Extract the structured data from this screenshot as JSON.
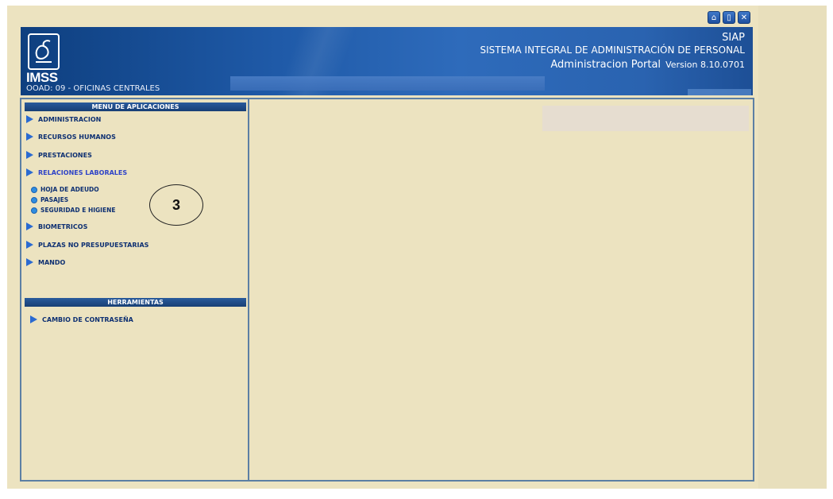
{
  "header": {
    "logo": "IMSS",
    "ooad": "OOAD: 09 - OFICINAS CENTRALES",
    "siap": "SIAP",
    "system_name": "SISTEMA INTEGRAL DE ADMINISTRACIÓN DE PERSONAL",
    "portal": "Administracion Portal",
    "version": "Version 8.10.0701"
  },
  "top_icons": [
    "home-icon",
    "document-icon",
    "close-icon"
  ],
  "menu": {
    "title": "MENU DE APLICACIONES",
    "items": [
      {
        "label": "ADMINISTRACION"
      },
      {
        "label": "RECURSOS HUMANOS"
      },
      {
        "label": "PRESTACIONES"
      },
      {
        "label": "RELACIONES LABORALES"
      },
      {
        "label": "BIOMETRICOS"
      },
      {
        "label": "PLAZAS NO PRESUPUESTARIAS"
      },
      {
        "label": "MANDO"
      }
    ],
    "subitems": [
      {
        "label": "HOJA DE ADEUDO"
      },
      {
        "label": "PASAJES"
      },
      {
        "label": "SEGURIDAD E HIGIENE"
      }
    ]
  },
  "tools": {
    "title": "HERRAMIENTAS",
    "items": [
      {
        "label": "CAMBIO DE CONTRASEÑA"
      }
    ]
  },
  "annotation": "3",
  "colors": {
    "banner": "#1f5aa8",
    "background": "#ece3c0",
    "menu_text": "#0e3072",
    "active_text": "#2e43c8",
    "border": "#5c7fa4"
  }
}
